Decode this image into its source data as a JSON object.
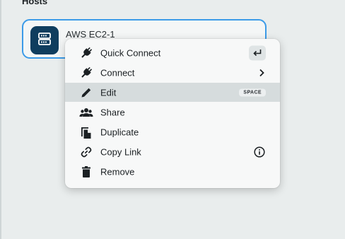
{
  "section": {
    "title": "Hosts"
  },
  "host": {
    "name": "AWS EC2-1",
    "icon": "server-icon",
    "accent": "#3c9be8",
    "avatar_color": "#0f3d5e"
  },
  "context_menu": {
    "items": [
      {
        "label": "Quick Connect",
        "icon": "plug-icon",
        "shortcut_icon": "enter-key-icon"
      },
      {
        "label": "Connect",
        "icon": "plug-icon",
        "trailing_icon": "chevron-right-icon"
      },
      {
        "label": "Edit",
        "icon": "pencil-icon",
        "shortcut": "SPACE",
        "highlighted": true
      },
      {
        "label": "Share",
        "icon": "users-icon"
      },
      {
        "label": "Duplicate",
        "icon": "duplicate-icon"
      },
      {
        "label": "Copy Link",
        "icon": "link-icon",
        "trailing_icon": "info-icon"
      },
      {
        "label": "Remove",
        "icon": "trash-icon"
      }
    ]
  }
}
